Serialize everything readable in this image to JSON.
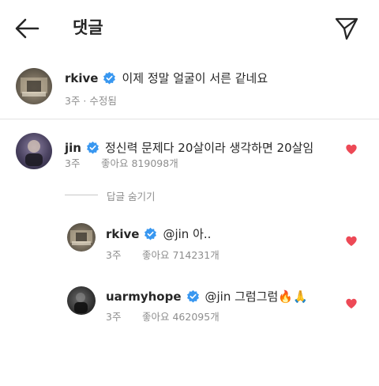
{
  "header": {
    "title": "댓글"
  },
  "caption": {
    "username": "rkive",
    "text": "이제 정말 얼굴이 서른 같네요",
    "meta": "3주 · 수정됨"
  },
  "comment": {
    "username": "jin",
    "text": "정신력 문제다 20살이라 생각하면 20살임",
    "time": "3주",
    "likes": "좋아요 819098개"
  },
  "hide_replies_label": "답글 숨기기",
  "replies": [
    {
      "username": "rkive",
      "mention": "@jin",
      "text": " 아..",
      "time": "3주",
      "likes": "좋아요 714231개"
    },
    {
      "username": "uarmyhope",
      "mention": "@jin",
      "text": " 그럼그럼🔥🙏",
      "time": "3주",
      "likes": "좋아요 462095개"
    }
  ],
  "colors": {
    "verified": "#3897f0",
    "heart": "#ed4956",
    "meta": "#8e8e8e"
  },
  "icons": {
    "back": "arrow-left-icon",
    "share": "send-icon",
    "verified": "verified-badge-icon",
    "like": "heart-filled-icon"
  }
}
